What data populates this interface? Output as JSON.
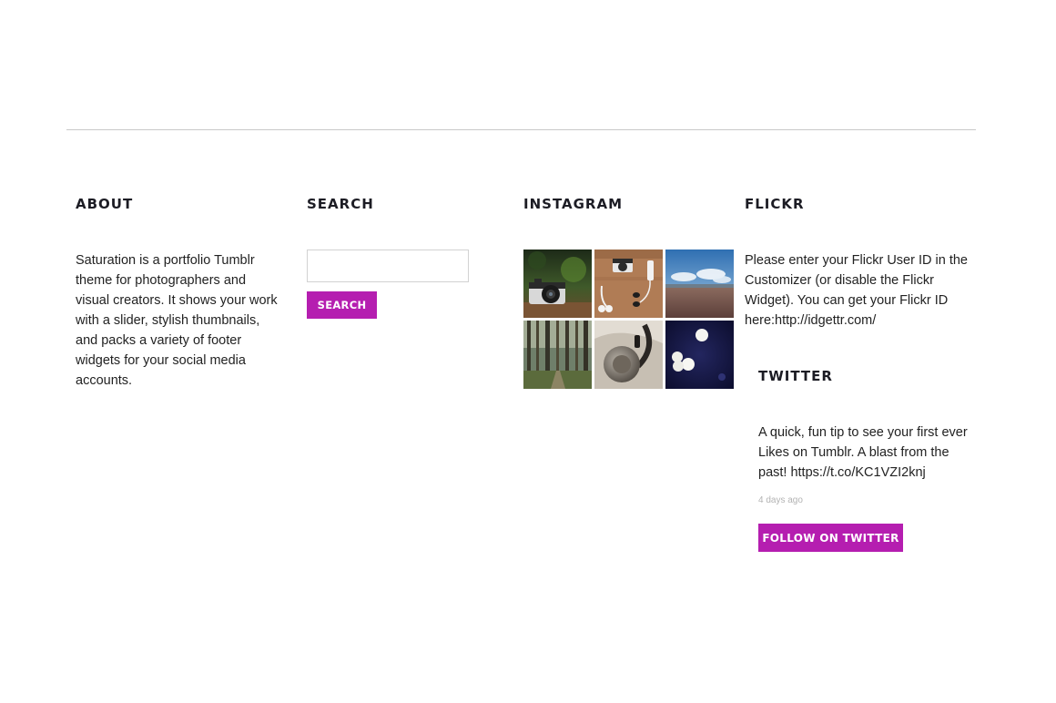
{
  "about": {
    "heading": "ABOUT",
    "text": "Saturation is a portfolio Tumblr theme for photographers and visual creators. It shows your work with a slider, stylish thumbnails, and packs a variety of footer widgets for your social media accounts."
  },
  "search": {
    "heading": "SEARCH",
    "input_value": "",
    "button_label": "SEARCH"
  },
  "instagram": {
    "heading": "INSTAGRAM",
    "photos": [
      {
        "icon": "camera-on-table-photo"
      },
      {
        "icon": "camera-headphones-desk-photo"
      },
      {
        "icon": "beach-sky-photo"
      },
      {
        "icon": "forest-trees-photo"
      },
      {
        "icon": "headphones-closeup-photo"
      },
      {
        "icon": "blue-bokeh-lights-photo"
      }
    ]
  },
  "flickr": {
    "heading": "FLICKR",
    "text": "Please enter your Flickr User ID in the Customizer (or disable the Flickr Widget). You can get your Flickr ID here:http://idgettr.com/"
  },
  "twitter": {
    "heading": "TWITTER",
    "tweet": "A quick, fun tip to see your first ever Likes on Tumblr. A blast from the past! https://t.co/KC1VZI2knj",
    "time": "4 days ago",
    "follow_label": "FOLLOW ON TWITTER"
  },
  "colors": {
    "accent": "#b51eb0",
    "divider": "#c9c9c9",
    "heading": "#1c1c24"
  }
}
